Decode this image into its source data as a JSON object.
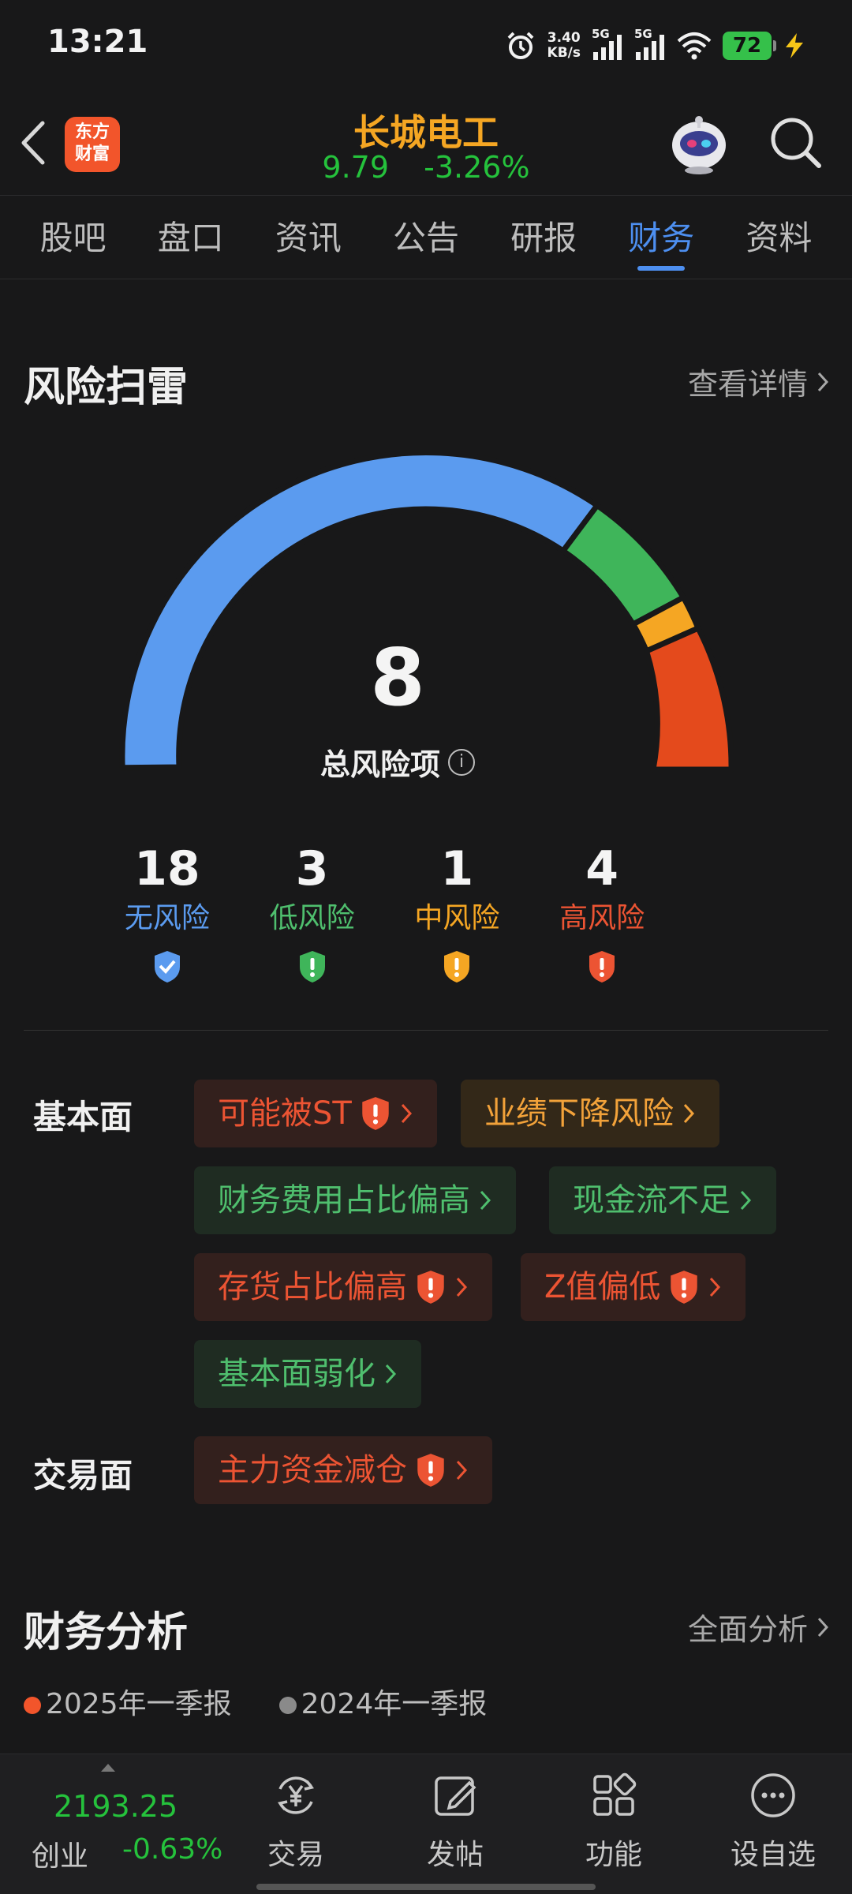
{
  "status_bar": {
    "time": "13:21",
    "net_speed_value": "3.40",
    "net_speed_unit": "KB/s",
    "signal_label_1": "5G",
    "signal_label_2": "5G",
    "battery": "72",
    "icons": [
      "alarm-icon",
      "signal-icon",
      "wifi-icon",
      "battery-icon",
      "charging-icon"
    ]
  },
  "header": {
    "logo_line1": "东方",
    "logo_line2": "财富",
    "stock_name": "长城电工",
    "price": "9.79",
    "change_pct": "-3.26%",
    "name_color": "#f5a623",
    "price_color": "#25c23c"
  },
  "tabs": [
    {
      "label": "股吧",
      "active": false
    },
    {
      "label": "盘口",
      "active": false
    },
    {
      "label": "资讯",
      "active": false
    },
    {
      "label": "公告",
      "active": false
    },
    {
      "label": "研报",
      "active": false
    },
    {
      "label": "财务",
      "active": true
    },
    {
      "label": "资料",
      "active": false
    }
  ],
  "risk_scan": {
    "title": "风险扫雷",
    "detail_link": "查看详情",
    "total": "8",
    "total_label": "总风险项",
    "segments": [
      {
        "name": "无风险",
        "count": "18",
        "color": "#5b9bef"
      },
      {
        "name": "低风险",
        "count": "3",
        "color": "#3fb55a"
      },
      {
        "name": "中风险",
        "count": "1",
        "color": "#f5a623"
      },
      {
        "name": "高风险",
        "count": "4",
        "color": "#e44a1c"
      }
    ],
    "rows": [
      {
        "label": "基本面",
        "chips": [
          {
            "text": "可能被ST",
            "level": "red",
            "warn": true
          },
          {
            "text": "业绩下降风险",
            "level": "orange",
            "warn": false
          },
          {
            "text": "财务费用占比偏高",
            "level": "green",
            "warn": false
          },
          {
            "text": "现金流不足",
            "level": "green",
            "warn": false
          },
          {
            "text": "存货占比偏高",
            "level": "red",
            "warn": true
          },
          {
            "text": "Z值偏低",
            "level": "red",
            "warn": true
          },
          {
            "text": "基本面弱化",
            "level": "green",
            "warn": false
          }
        ]
      },
      {
        "label": "交易面",
        "chips": [
          {
            "text": "主力资金减仓",
            "level": "red",
            "warn": true
          }
        ]
      }
    ]
  },
  "financial_analysis": {
    "title": "财务分析",
    "link": "全面分析",
    "legend": [
      {
        "label": "2025年一季报",
        "color": "#f2552b"
      },
      {
        "label": "2024年一季报",
        "color": "#8a8a8a"
      }
    ]
  },
  "bottom_bar": {
    "index_value": "2193.25",
    "index_name": "创业",
    "index_change": "-0.63%",
    "buttons": [
      {
        "label": "交易",
        "icon": "trade-yen-icon"
      },
      {
        "label": "发帖",
        "icon": "compose-icon"
      },
      {
        "label": "功能",
        "icon": "apps-grid-icon"
      },
      {
        "label": "设自选",
        "icon": "more-dots-icon"
      }
    ]
  }
}
